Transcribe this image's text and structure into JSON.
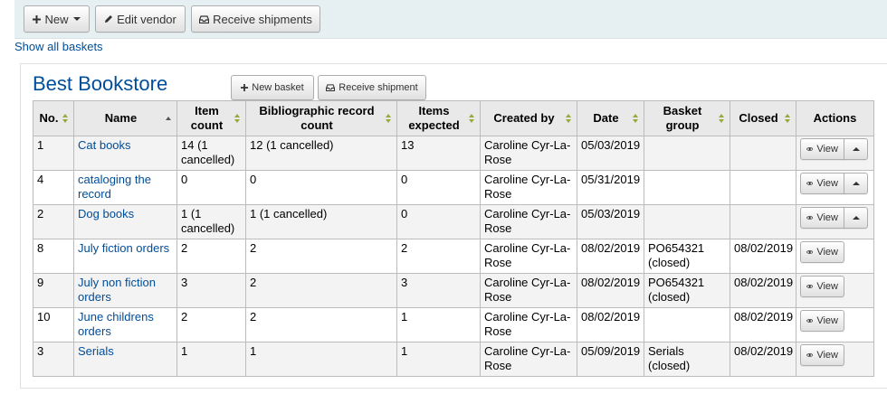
{
  "toolbar": {
    "new_label": "New",
    "edit_vendor_label": "Edit vendor",
    "receive_shipments_label": "Receive shipments"
  },
  "show_all_baskets": "Show all baskets",
  "vendor": {
    "name": "Best Bookstore",
    "new_basket_label": "New basket",
    "receive_shipment_label": "Receive shipment"
  },
  "table": {
    "headers": [
      "No.",
      "Name",
      "Item count",
      "Bibliographic record count",
      "Items expected",
      "Created by",
      "Date",
      "Basket group",
      "Closed",
      "Actions"
    ],
    "view_label": "View",
    "rows": [
      {
        "no": "1",
        "name": "Cat books",
        "item_count": "14 (1 cancelled)",
        "bib_count": "12 (1 cancelled)",
        "expected": "13",
        "created_by": "Caroline Cyr-La-Rose",
        "date": "05/03/2019",
        "group": "",
        "closed": "",
        "has_toggle": true
      },
      {
        "no": "4",
        "name": "cataloging the record",
        "item_count": "0",
        "bib_count": "0",
        "expected": "0",
        "created_by": "Caroline Cyr-La-Rose",
        "date": "05/31/2019",
        "group": "",
        "closed": "",
        "has_toggle": true
      },
      {
        "no": "2",
        "name": "Dog books",
        "item_count": "1 (1 cancelled)",
        "bib_count": "1 (1 cancelled)",
        "expected": "0",
        "created_by": "Caroline Cyr-La-Rose",
        "date": "05/03/2019",
        "group": "",
        "closed": "",
        "has_toggle": true
      },
      {
        "no": "8",
        "name": "July fiction orders",
        "item_count": "2",
        "bib_count": "2",
        "expected": "2",
        "created_by": "Caroline Cyr-La-Rose",
        "date": "08/02/2019",
        "group": "PO654321 (closed)",
        "closed": "08/02/2019",
        "has_toggle": false
      },
      {
        "no": "9",
        "name": "July non fiction orders",
        "item_count": "3",
        "bib_count": "2",
        "expected": "3",
        "created_by": "Caroline Cyr-La-Rose",
        "date": "08/02/2019",
        "group": "PO654321 (closed)",
        "closed": "08/02/2019",
        "has_toggle": false
      },
      {
        "no": "10",
        "name": "June childrens orders",
        "item_count": "2",
        "bib_count": "2",
        "expected": "1",
        "created_by": "Caroline Cyr-La-Rose",
        "date": "08/02/2019",
        "group": "",
        "closed": "08/02/2019",
        "has_toggle": false
      },
      {
        "no": "3",
        "name": "Serials",
        "item_count": "1",
        "bib_count": "1",
        "expected": "1",
        "created_by": "Caroline Cyr-La-Rose",
        "date": "05/09/2019",
        "group": "Serials (closed)",
        "closed": "08/02/2019",
        "has_toggle": false
      }
    ]
  },
  "colors": {
    "link": "#004d99",
    "toolbar_bg": "#e6f0f2",
    "header_bg": "#e9e9e9",
    "sort_arrow": "#9aa83a"
  },
  "icons": {
    "new": "plus-icon",
    "edit": "pencil-icon",
    "receive": "inbox-icon",
    "view": "eye-icon"
  }
}
